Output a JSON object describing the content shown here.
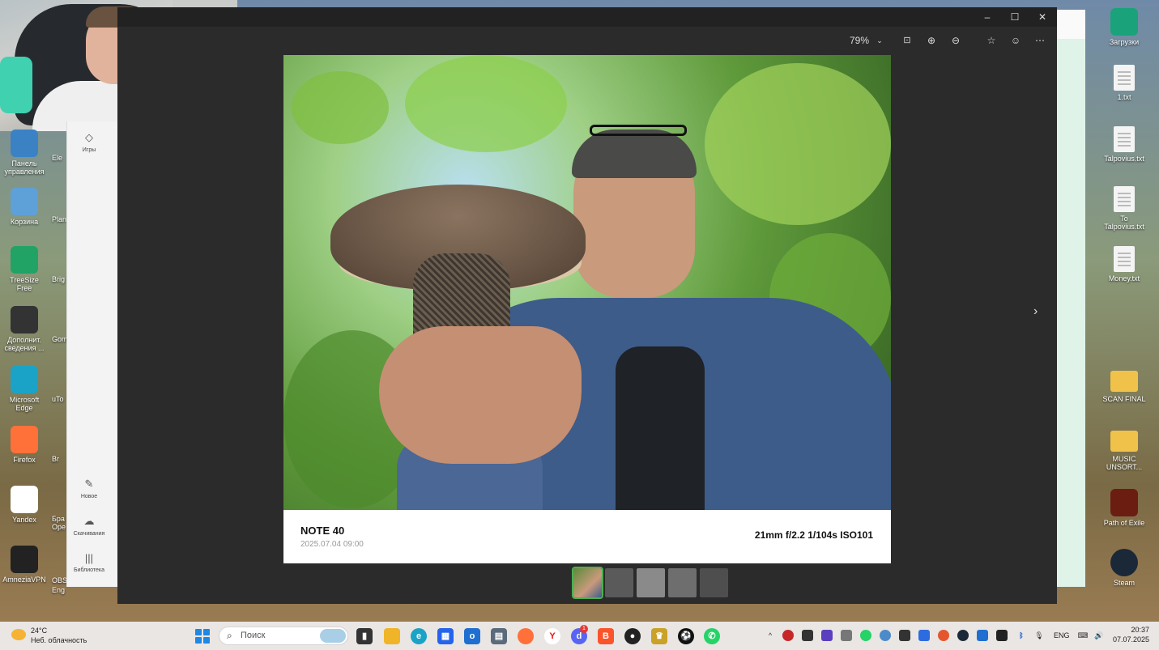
{
  "desktop": {
    "left_icons": [
      {
        "label": "Панель управления",
        "icon": "control-panel-icon",
        "color": "#3b82c4"
      },
      {
        "label": "Корзина",
        "icon": "recycle-bin-icon",
        "color": "#5ea0d8"
      },
      {
        "label": "TreeSize Free",
        "icon": "treesize-icon",
        "color": "#21a366"
      },
      {
        "label": "Дополнит. сведения ...",
        "icon": "info-icon",
        "color": "#333333"
      },
      {
        "label": "Microsoft Edge",
        "icon": "edge-icon",
        "color": "#1aa3c6"
      },
      {
        "label": "Firefox",
        "icon": "firefox-icon",
        "color": "#ff7139"
      },
      {
        "label": "Yandex",
        "icon": "yandex-icon",
        "color": "#ffffff"
      },
      {
        "label": "AmneziaVPN",
        "icon": "amnezia-icon",
        "color": "#222222"
      }
    ],
    "second_column_partial": [
      "Ele",
      "Plan",
      "Brig",
      "Gom",
      "uTo",
      "Br",
      "Бра Оре",
      "OBS",
      "Eng"
    ],
    "right_icons": [
      {
        "label": "Загрузки",
        "icon": "downloads-icon",
        "kind": "app"
      },
      {
        "label": "1.txt",
        "icon": "text-file-icon",
        "kind": "doc"
      },
      {
        "label": "Talpovius.txt",
        "icon": "text-file-icon",
        "kind": "doc"
      },
      {
        "label": "To Talpovius.txt",
        "icon": "text-file-icon",
        "kind": "doc"
      },
      {
        "label": "Money.txt",
        "icon": "text-file-icon",
        "kind": "doc"
      },
      {
        "label": "SCAN FINAL",
        "icon": "folder-icon",
        "kind": "folder"
      },
      {
        "label": "MUSIC UNSORT...",
        "icon": "folder-icon",
        "kind": "folder"
      },
      {
        "label": "Path of Exile",
        "icon": "poe-icon",
        "kind": "app"
      },
      {
        "label": "Steam",
        "icon": "steam-icon",
        "kind": "app"
      }
    ]
  },
  "store_sidebar": {
    "games_label": "Игры",
    "new_label": "Новое",
    "downloads_label": "Скачивания",
    "library_label": "Библиотека"
  },
  "viewer": {
    "zoom": "79%",
    "photo": {
      "model": "NOTE 40",
      "datetime": "2025.07.04 09:00",
      "exif": "21mm f/2.2 1/104s ISO101"
    },
    "thumbnails": 5
  },
  "taskbar": {
    "weather_temp": "24°C",
    "weather_desc": "Неб. облачность",
    "search_placeholder": "Поиск",
    "language": "ENG",
    "time": "20:37",
    "date": "07.07.2025",
    "discord_badge": "1"
  }
}
